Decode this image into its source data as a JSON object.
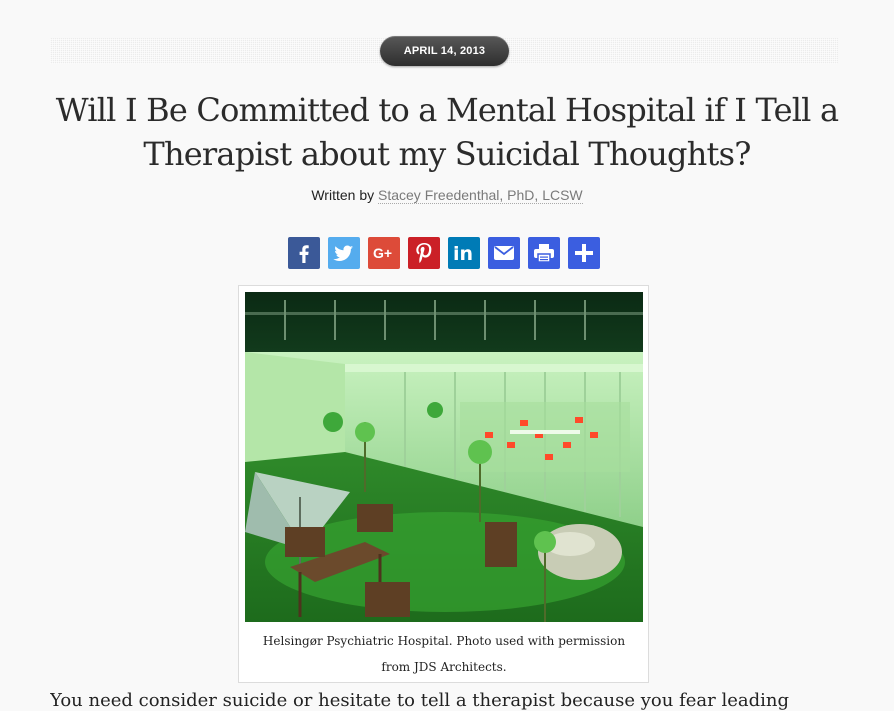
{
  "post": {
    "date": "APRIL 14, 2013",
    "title": "Will I Be Committed to a Mental Hospital if I Tell a Therapist about my Suicidal Thoughts?",
    "byline_prefix": "Written by ",
    "author": "Stacey Freedenthal, PhD, LCSW"
  },
  "share": [
    {
      "name": "facebook",
      "icon": "facebook-icon",
      "color": "#3b5998"
    },
    {
      "name": "twitter",
      "icon": "twitter-icon",
      "color": "#55acee"
    },
    {
      "name": "google-plus",
      "icon": "google-plus-icon",
      "color": "#dd4b39"
    },
    {
      "name": "pinterest",
      "icon": "pinterest-icon",
      "color": "#cb2027"
    },
    {
      "name": "linkedin",
      "icon": "linkedin-icon",
      "color": "#007bb6"
    },
    {
      "name": "email",
      "icon": "email-icon",
      "color": "#3b5ee0"
    },
    {
      "name": "print",
      "icon": "print-icon",
      "color": "#3b5ee0"
    },
    {
      "name": "more",
      "icon": "share-plus-icon",
      "color": "#3b5ee0"
    }
  ],
  "figure": {
    "caption": "Helsingør Psychiatric Hospital. Photo used with permission from JDS Architects."
  },
  "body": {
    "first_line": "You need consider suicide or hesitate to tell a therapist because you fear leading"
  }
}
